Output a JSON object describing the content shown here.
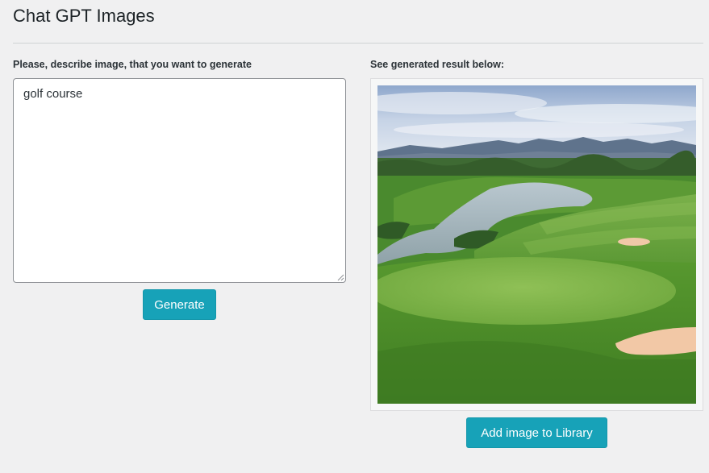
{
  "page": {
    "title": "Chat GPT Images"
  },
  "prompt": {
    "label": "Please, describe image, that you want to generate",
    "value": "golf course"
  },
  "generate_button": {
    "label": "Generate"
  },
  "result": {
    "label": "See generated result below:",
    "image_icon": "generated-golf-course-image"
  },
  "library_button": {
    "label": "Add image to Library"
  },
  "colors": {
    "accent": "#17a2b8",
    "background": "#f0f0f1"
  }
}
